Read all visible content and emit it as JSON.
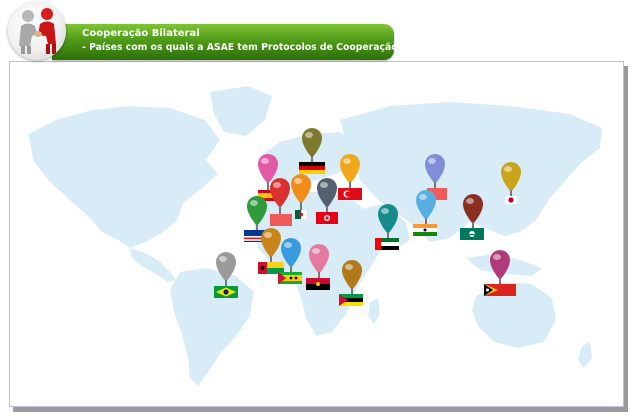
{
  "header": {
    "title": "Cooperação Bilateral",
    "subtitle": "- Países com os quais a ASAE tem Protocolos de Cooperação Bilateral"
  },
  "colors": {
    "banner_green": "#4f9b18",
    "map_land": "#d8ecf7",
    "frame_border": "#c9b9dd"
  },
  "map": {
    "pins": [
      {
        "id": "portugal",
        "color": "#e05aa5",
        "flag": "spain-flag"
      },
      {
        "id": "italy",
        "color": "#d93030",
        "flag": "red-flag"
      },
      {
        "id": "algeria",
        "color": "#f08c1a",
        "flag": "algeria-flag"
      },
      {
        "id": "germany",
        "color": "#7d7a2e",
        "flag": "germany-flag"
      },
      {
        "id": "turkey",
        "color": "#f0a81a",
        "flag": "turkey-flag"
      },
      {
        "id": "tunisia",
        "color": "#55606e",
        "flag": "tunisia-flag"
      },
      {
        "id": "russia",
        "color": "#7f8ed8",
        "flag": "red-flag"
      },
      {
        "id": "japan",
        "color": "#c9a41a",
        "flag": "japan-flag"
      },
      {
        "id": "cape-verde",
        "color": "#2e9a3a",
        "flag": "cape-verde-flag"
      },
      {
        "id": "guinea-bissau",
        "color": "#c8861a",
        "flag": "guinea-bissau-flag"
      },
      {
        "id": "sao-tome",
        "color": "#3a9ae0",
        "flag": "sao-tome-flag"
      },
      {
        "id": "angola",
        "color": "#e57aa0",
        "flag": "angola-flag"
      },
      {
        "id": "mozambique",
        "color": "#b07a18",
        "flag": "mozambique-flag"
      },
      {
        "id": "uae",
        "color": "#178c8c",
        "flag": "uae-flag"
      },
      {
        "id": "india",
        "color": "#58aee0",
        "flag": "india-flag"
      },
      {
        "id": "macau",
        "color": "#8a2e22",
        "flag": "macau-flag"
      },
      {
        "id": "timor",
        "color": "#b03a7a",
        "flag": "timor-flag"
      },
      {
        "id": "brazil",
        "color": "#9a9a9a",
        "flag": "brazil-flag"
      }
    ]
  }
}
